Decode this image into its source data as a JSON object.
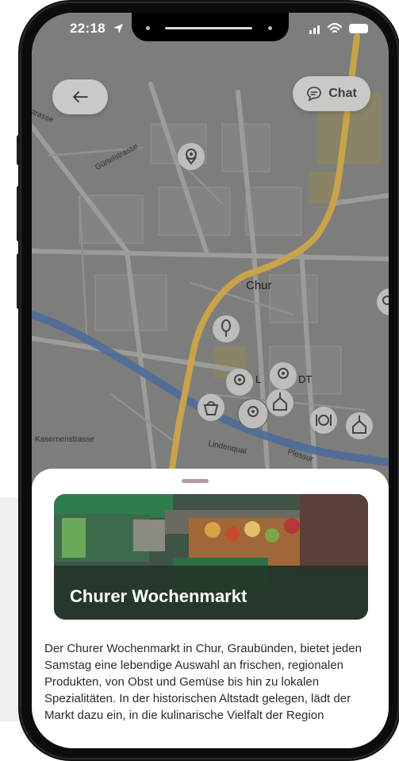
{
  "status_bar": {
    "time": "22:18"
  },
  "header": {
    "chat_label": "Chat"
  },
  "map": {
    "city_label": "Chur",
    "partial_label_1": "L",
    "partial_label_2": "DT",
    "streets": {
      "street_1": "Gürtelstrasse",
      "street_2": "strasse",
      "street_3": "Kasernenstrasse",
      "street_4": "Lindenquai",
      "street_5": "Plessur"
    }
  },
  "detail": {
    "title": "Churer Wochenmarkt",
    "description": "Der Churer Wochenmarkt in Chur, Graubünden, bietet jeden Samstag eine lebendige Auswahl an frischen, regionalen Produkten, von Obst und Gemüse bis hin zu lokalen Spezialitäten. In der historischen Altstadt gelegen, lädt der Markt dazu ein, in die kulinarische Vielfalt der Region"
  },
  "colors": {
    "road_main": "#c9a34a",
    "river": "#4b6a9c",
    "map_dim": "#7d7d7b"
  }
}
